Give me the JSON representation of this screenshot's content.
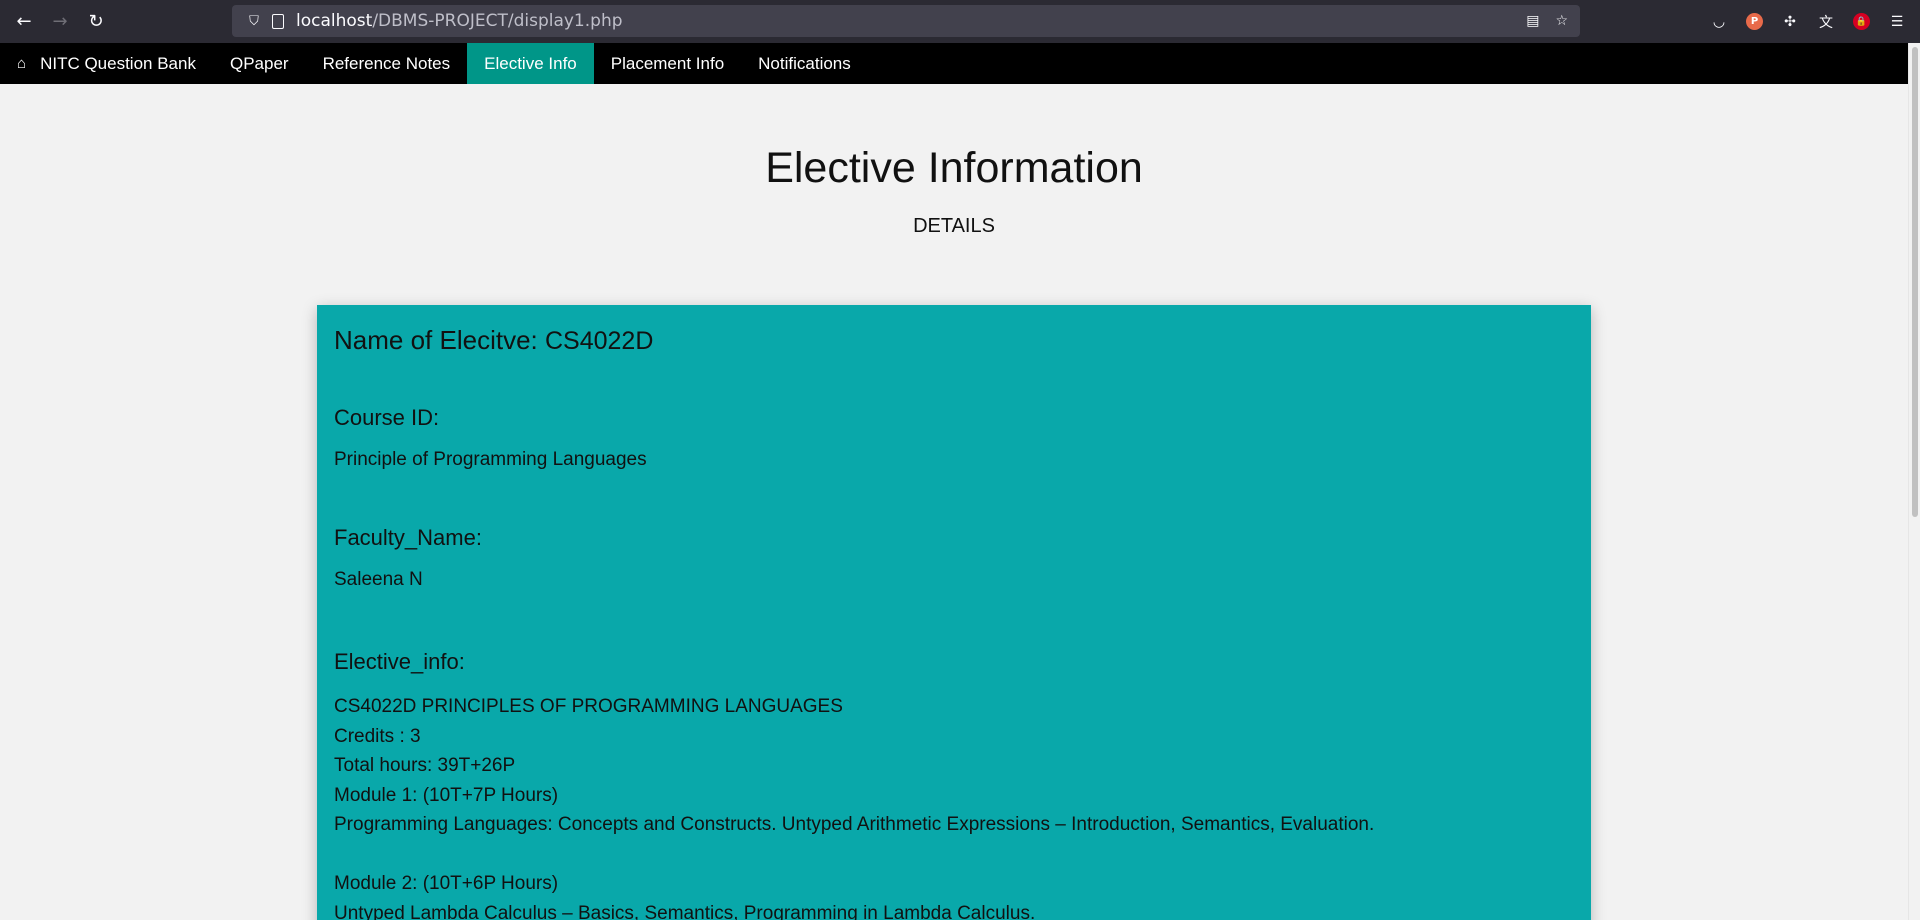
{
  "browser": {
    "url_host": "localhost",
    "url_path": "/DBMS-PROJECT/display1.php"
  },
  "nav": {
    "brand": "NITC Question Bank",
    "items": [
      "QPaper",
      "Reference Notes",
      "Elective Info",
      "Placement Info",
      "Notifications"
    ],
    "active": "Elective Info"
  },
  "header": {
    "title": "Elective Information",
    "subtitle": "DETAILS"
  },
  "elective": {
    "name_label": "Name of Elecitve:",
    "name_value": "CS4022D",
    "course_id_label": "Course ID:",
    "course_id_value": "Principle of Programming Languages",
    "faculty_label": "Faculty_Name:",
    "faculty_value": "Saleena N",
    "info_label": "Elective_info:",
    "info_lines": [
      "CS4022D PRINCIPLES OF PROGRAMMING LANGUAGES",
      "Credits : 3",
      "Total hours: 39T+26P",
      "Module 1: (10T+7P Hours)",
      "Programming Languages: Concepts and Constructs. Untyped Arithmetic Expressions – Introduction, Semantics, Evaluation.",
      "",
      "Module 2: (10T+6P Hours)",
      "Untyped Lambda Calculus – Basics, Semantics, Programming in Lambda Calculus."
    ]
  },
  "colors": {
    "nav_active": "#009688",
    "card_bg": "#09a8aa",
    "page_bg": "#f2f2f2"
  }
}
